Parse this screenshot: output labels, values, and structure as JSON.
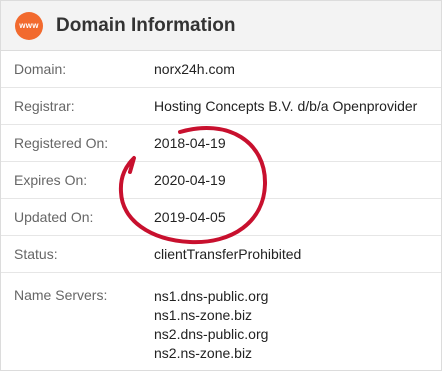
{
  "header": {
    "icon_text": "www",
    "title": "Domain Information"
  },
  "rows": [
    {
      "label": "Domain:",
      "value": "norx24h.com"
    },
    {
      "label": "Registrar:",
      "value": "Hosting Concepts B.V. d/b/a Openprovider"
    },
    {
      "label": "Registered On:",
      "value": "2018-04-19"
    },
    {
      "label": "Expires On:",
      "value": "2020-04-19"
    },
    {
      "label": "Updated On:",
      "value": "2019-04-05"
    },
    {
      "label": "Status:",
      "value": "clientTransferProhibited"
    }
  ],
  "name_servers": {
    "label": "Name Servers:",
    "values": [
      "ns1.dns-public.org",
      "ns1.ns-zone.biz",
      "ns2.dns-public.org",
      "ns2.ns-zone.biz"
    ]
  },
  "colors": {
    "icon_bg": "#f26a2e",
    "annotation": "#c8102e"
  }
}
